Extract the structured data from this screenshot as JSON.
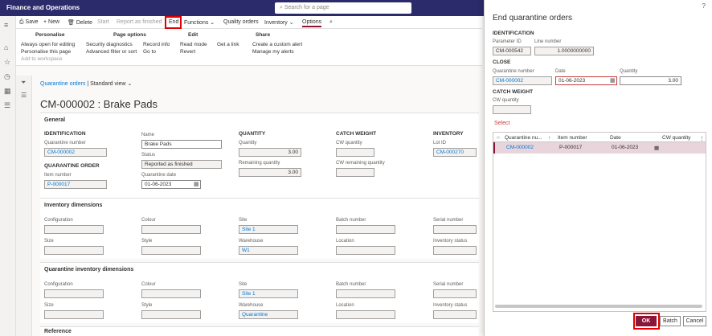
{
  "app": {
    "title": "Finance and Operations",
    "search_placeholder": "Search for a page"
  },
  "toolbar": {
    "save": "Save",
    "new": "New",
    "delete": "Delete",
    "start": "Start",
    "report": "Report as finished",
    "end": "End",
    "functions": "Functions",
    "quality": "Quality orders",
    "inventory": "Inventory",
    "options": "Options"
  },
  "ribbon": {
    "personalise": {
      "title": "Personalise",
      "items": [
        "Always open for editing",
        "Personalise this page",
        "Add to workspace"
      ]
    },
    "page_options": {
      "title": "Page options",
      "items": [
        "Security diagnostics",
        "Advanced filter or sort",
        "Record info",
        "Go to"
      ]
    },
    "edit": {
      "title": "Edit",
      "items": [
        "Read mode",
        "Revert"
      ]
    },
    "link": {
      "items": [
        "Get a link"
      ]
    },
    "share": {
      "title": "Share",
      "items": [
        "Create a custom alert",
        "Manage my alerts"
      ]
    }
  },
  "breadcrumb": {
    "link": "Quarantine orders",
    "view": "Standard view"
  },
  "page_title": "CM-000002 : Brake Pads",
  "general": {
    "header": "General",
    "identification": "IDENTIFICATION",
    "quarantine_number_label": "Quarantine number",
    "quarantine_number": "CM-000002",
    "quarantine_order": "QUARANTINE ORDER",
    "item_number_label": "Item number",
    "item_number": "P-000017",
    "name_label": "Name",
    "name": "Brake Pads",
    "status_label": "Status",
    "status": "Reported as finished",
    "date_label": "Quarantine date",
    "date": "01-06-2023",
    "quantity": "QUANTITY",
    "qty_label": "Quantity",
    "qty": "3.00",
    "rem_label": "Remaining quantity",
    "rem": "3.00",
    "catch_weight": "CATCH WEIGHT",
    "cw_qty_label": "CW quantity",
    "cw_rem_label": "CW remaining quantity",
    "inventory": "INVENTORY",
    "lot_label": "Lot ID",
    "lot": "CM-000270"
  },
  "inv_dims": {
    "header": "Inventory dimensions",
    "labels": [
      "Configuration",
      "Colour",
      "Site",
      "Batch number",
      "Serial number",
      "Size",
      "Style",
      "Warehouse",
      "Location",
      "Inventory status"
    ],
    "site": "Site 1",
    "warehouse": "W1"
  },
  "q_dims": {
    "header": "Quarantine inventory dimensions",
    "labels": [
      "Configuration",
      "Colour",
      "Site",
      "Batch number",
      "Serial number",
      "Size",
      "Style",
      "Warehouse",
      "Location",
      "Inventory status"
    ],
    "site": "Site 1",
    "warehouse": "Quarantine"
  },
  "reference": "Reference",
  "dialog": {
    "title": "End quarantine orders",
    "help": "?",
    "identification": "IDENTIFICATION",
    "param_label": "Parameter ID",
    "param": "CM-000542",
    "line_label": "Line number",
    "line": "1.0000000000",
    "close": "CLOSE",
    "qnum_label": "Quarantine number",
    "qnum": "CM-000002",
    "date_label": "Date",
    "date": "01-06-2023",
    "qty_label": "Quantity",
    "qty": "3.00",
    "catch_weight": "CATCH WEIGHT",
    "cw_label": "CW quantity",
    "select": "Select",
    "grid_headers": [
      "Quarantine nu...",
      "Item number",
      "Date",
      "CW quantity"
    ],
    "row": {
      "qnum": "CM-000002",
      "item": "P-000017",
      "date": "01-06-2023"
    },
    "ok": "OK",
    "batch": "Batch",
    "cancel": "Cancel"
  },
  "colors": {
    "topbar": "#2b2a6b",
    "accent": "#8a1538",
    "link": "#0078d4",
    "highlight": "#e00000"
  }
}
